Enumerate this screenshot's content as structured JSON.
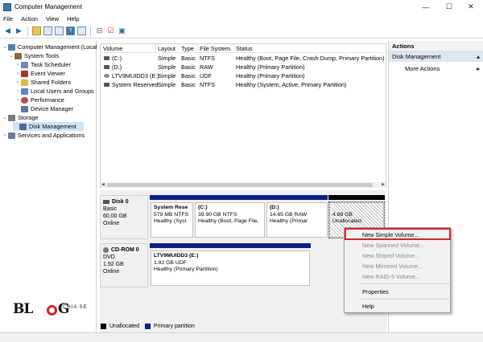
{
  "window": {
    "title": "Computer Management",
    "controls": {
      "minimize": "—",
      "maximize": "☐",
      "close": "✕"
    }
  },
  "menu": [
    "File",
    "Action",
    "View",
    "Help"
  ],
  "tree": {
    "root": "Computer Management (Local",
    "system_tools": "System Tools",
    "task_scheduler": "Task Scheduler",
    "event_viewer": "Event Viewer",
    "shared_folders": "Shared Folders",
    "local_users": "Local Users and Groups",
    "performance": "Performance",
    "device_manager": "Device Manager",
    "storage": "Storage",
    "disk_management": "Disk Management",
    "services": "Services and Applications"
  },
  "volume_table": {
    "headers": [
      "Volume",
      "Layout",
      "Type",
      "File System",
      "Status"
    ],
    "rows": [
      [
        "(C:)",
        "Simple",
        "Basic",
        "NTFS",
        "Healthy (Boot, Page File, Crash Dump, Primary Partition)"
      ],
      [
        "(D:)",
        "Simple",
        "Basic",
        "RAW",
        "Healthy (Primary Partition)"
      ],
      [
        "LTV9MUIDD3 (E:)",
        "Simple",
        "Basic",
        "UDF",
        "Healthy (Primary Partition)"
      ],
      [
        "System Reserved",
        "Simple",
        "Basic",
        "NTFS",
        "Healthy (System, Active, Primary Partition)"
      ]
    ]
  },
  "disk0": {
    "name": "Disk 0",
    "type": "Basic",
    "size": "60.00 GB",
    "state": "Online",
    "partitions": [
      {
        "name": "System Rese",
        "info": "579 MB NTFS",
        "status": "Healthy (Syst"
      },
      {
        "name": "(C:)",
        "info": "39.90 GB NTFS",
        "status": "Healthy (Boot, Page File,"
      },
      {
        "name": "(D:)",
        "info": "14.65 GB RAW",
        "status": "Healthy (Primar"
      },
      {
        "name": "",
        "info": "4.88 GB",
        "status": "Unallocated"
      }
    ]
  },
  "cdrom0": {
    "name": "CD-ROM 0",
    "type": "DVD",
    "size": "1.92 GB",
    "state": "Online",
    "partition": {
      "name": "LTV9MUIDD3 (E:)",
      "info": "1.92 GB UDF",
      "status": "Healthy (Primary Partition)"
    }
  },
  "legend": {
    "unallocated": "Unallocated",
    "primary": "Primary partition"
  },
  "actions": {
    "header": "Actions",
    "section": "Disk Management",
    "more": "More Actions"
  },
  "context_menu": {
    "items": [
      "New Simple Volume...",
      "New Spanned Volume...",
      "New Striped Volume...",
      "New Mirrored Volume...",
      "New RAID-5 Volume...",
      "Properties",
      "Help"
    ]
  },
  "watermark": {
    "left": "BL",
    "right": "G",
    "tag": "CHIA SE"
  },
  "colors": {
    "primary_partition": "#0a1e8c",
    "unallocated": "#000000",
    "selection": "#cce4f7",
    "highlight": "#e0202a"
  }
}
